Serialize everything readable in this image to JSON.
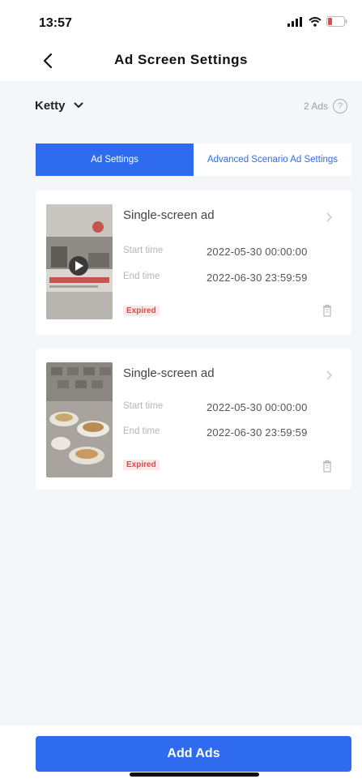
{
  "status_bar": {
    "time": "13:57",
    "icons": [
      "signal-icon",
      "wifi-icon",
      "battery-icon"
    ]
  },
  "nav": {
    "title": "Ad Screen Settings",
    "back_icon": "chevron-left-icon"
  },
  "account": {
    "name": "Ketty",
    "ad_count": "2 Ads",
    "help_symbol": "?"
  },
  "tabs": [
    {
      "label": "Ad Settings",
      "active": true
    },
    {
      "label": "Advanced Scenario Ad Settings",
      "active": false
    }
  ],
  "ads": [
    {
      "title": "Single-screen ad",
      "start_label": "Start time",
      "start_value": "2022-05-30 00:00:00",
      "end_label": "End time",
      "end_value": "2022-06-30 23:59:59",
      "status": "Expired"
    },
    {
      "title": "Single-screen ad",
      "start_label": "Start time",
      "start_value": "2022-05-30 00:00:00",
      "end_label": "End time",
      "end_value": "2022-06-30 23:59:59",
      "status": "Expired"
    }
  ],
  "footer": {
    "add_button": "Add Ads"
  },
  "colors": {
    "accent": "#2f6bef",
    "background": "#f4f6fa",
    "expired_text": "#d94b4b",
    "expired_bg": "#fde8e8"
  }
}
